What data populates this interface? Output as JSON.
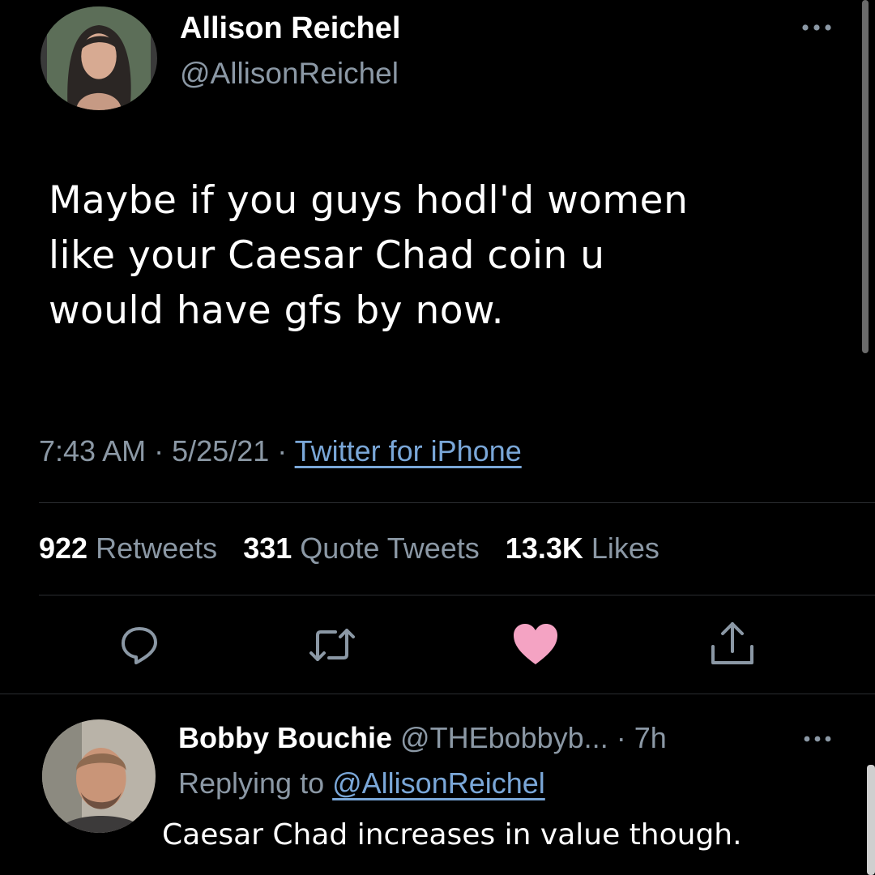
{
  "tweet": {
    "author_name": "Allison Reichel",
    "author_handle": "@AllisonReichel",
    "text_lines": [
      "Maybe if you guys hodl'd women",
      "like your Caesar Chad coin u",
      "would have gfs by now."
    ],
    "time": "7:43 AM",
    "date": "5/25/21",
    "source": "Twitter for iPhone",
    "separator": "·",
    "stats": {
      "retweets_count": "922",
      "retweets_label": "Retweets",
      "quotes_count": "331",
      "quotes_label": "Quote Tweets",
      "likes_count": "13.3K",
      "likes_label": "Likes"
    },
    "more_icon": "more-horizontal-icon",
    "actions": [
      "reply-icon",
      "retweet-icon",
      "heart-icon",
      "share-icon"
    ],
    "like_color": "#f4a3c3"
  },
  "reply": {
    "author_name": "Bobby Bouchie",
    "author_handle": "@THEbobbyb...",
    "time_ago": "· 7h",
    "replying_prefix": "Replying to",
    "replying_handle": "@AllisonReichel",
    "text": "Caesar Chad increases in value though."
  }
}
